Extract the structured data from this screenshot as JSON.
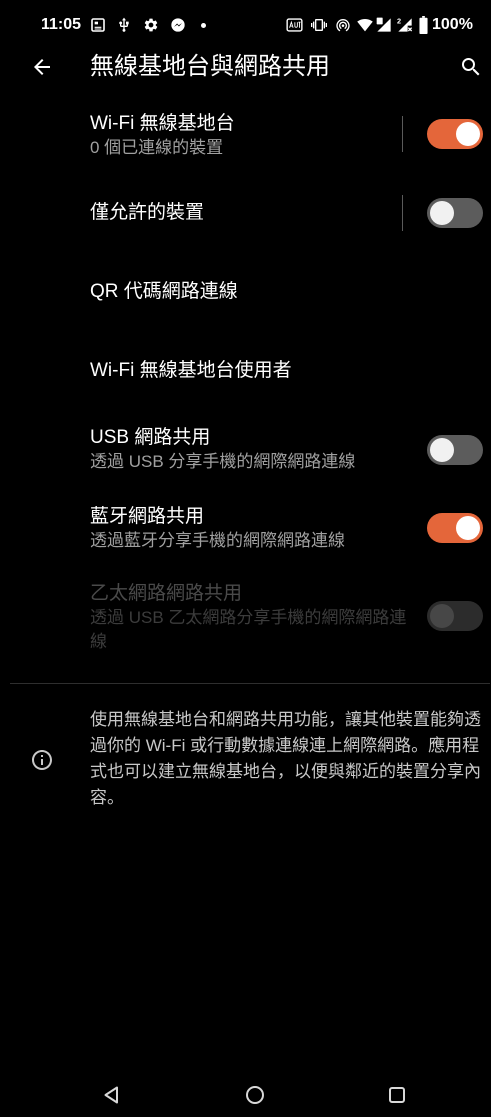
{
  "status_bar": {
    "time": "11:05",
    "battery_level": "100%",
    "sim2_label": "2",
    "notification_icons": [
      "image-notification-icon",
      "usb-icon",
      "gear-icon",
      "messenger-icon",
      "more-notifications-dot-icon"
    ],
    "system_icons": [
      "auto-icon",
      "vibrate-icon",
      "hotspot-icon",
      "wifi-icon",
      "signal-sim1-icon",
      "signal-sim2-no-service-icon",
      "battery-icon"
    ]
  },
  "app_bar": {
    "title": "無線基地台與網路共用",
    "navigation_icon": "arrow-back-icon",
    "action_icon": "search-icon"
  },
  "settings": [
    {
      "title": "Wi-Fi 無線基地台",
      "summary": "0 個已連線的裝置",
      "checked": true,
      "enabled": true
    },
    {
      "title": "僅允許的裝置",
      "checked": false,
      "enabled": true
    },
    {
      "title": "QR 代碼網路連線"
    },
    {
      "title": "Wi-Fi 無線基地台使用者"
    },
    {
      "title": "USB 網路共用",
      "summary": "透過 USB 分享手機的網際網路連線",
      "checked": false,
      "enabled": true
    },
    {
      "title": "藍牙網路共用",
      "summary": "透過藍牙分享手機的網際網路連線",
      "checked": true,
      "enabled": true
    },
    {
      "title": "乙太網路網路共用",
      "summary": "透過 USB 乙太網路分享手機的網際網路連線",
      "checked": false,
      "enabled": false
    }
  ],
  "info": {
    "icon": "info-icon",
    "text": "使用無線基地台和網路共用功能，讓其他裝置能夠透過你的 Wi-Fi 或行動數據連線連上網際網路。應用程式也可以建立無線基地台，以便與鄰近的裝置分享內容。"
  },
  "navigation_bar": {
    "buttons": [
      "nav-back-icon",
      "nav-home-icon",
      "nav-recents-icon"
    ]
  },
  "colors": {
    "accent": "#E4663A",
    "background": "#000000",
    "text_primary": "#FFFFFF",
    "text_secondary": "#A0A0A0",
    "text_info": "#C8C8C8",
    "text_disabled": "#4A4A4A",
    "switch_track_off": "#5C5C5C",
    "switch_thumb": "#F1F1F1",
    "divider": "#2E2E2E"
  }
}
